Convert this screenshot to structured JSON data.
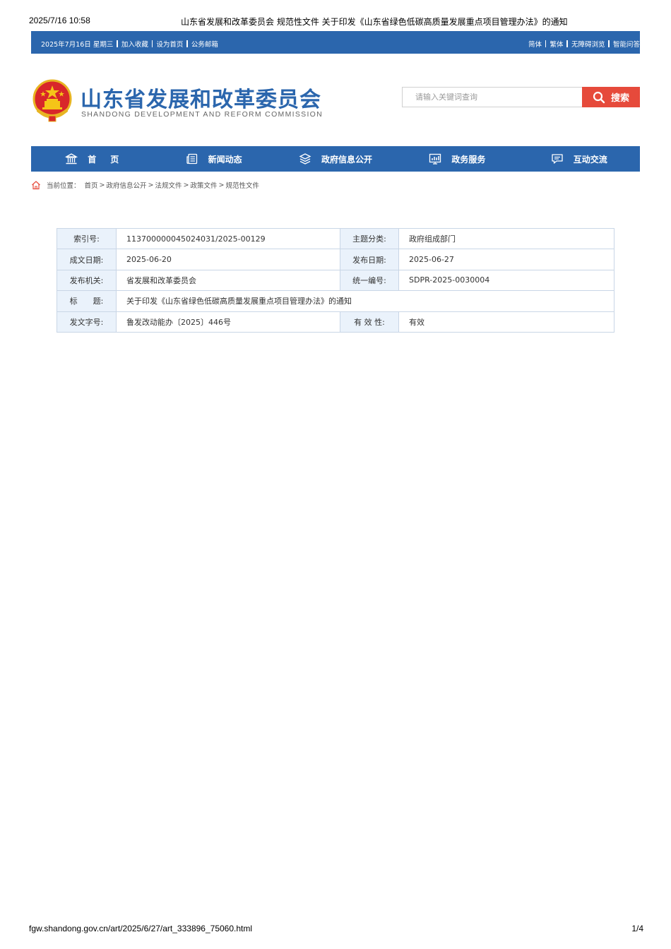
{
  "print_header": {
    "datetime": "2025/7/16 10:58",
    "page_title": "山东省发展和改革委员会 规范性文件 关于印发《山东省绿色低碳高质量发展重点项目管理办法》的通知"
  },
  "topbar": {
    "date_text": "2025年7月16日 星期三",
    "left_links": [
      "加入收藏",
      "设为首页",
      "公务邮箱"
    ],
    "right_links": [
      "简体",
      "繁体",
      "无障碍浏览",
      "智能问答"
    ]
  },
  "header": {
    "site_title": "山东省发展和改革委员会",
    "site_title_en": "SHANDONG DEVELOPMENT AND REFORM COMMISSION"
  },
  "search": {
    "placeholder": "请输入关键词查询",
    "button_label": "搜索"
  },
  "nav": {
    "items": [
      {
        "label": "首页",
        "icon": "building-icon"
      },
      {
        "label": "新闻动态",
        "icon": "news-icon"
      },
      {
        "label": "政府信息公开",
        "icon": "layers-icon"
      },
      {
        "label": "政务服务",
        "icon": "chart-board-icon"
      },
      {
        "label": "互动交流",
        "icon": "chat-icon"
      }
    ]
  },
  "breadcrumb": {
    "prefix": "当前位置：",
    "items": [
      "首页",
      "政府信息公开",
      "法规文件",
      "政策文件",
      "规范性文件"
    ]
  },
  "meta": {
    "index_label": "索引号:",
    "index_value": "113700000045024031/2025-00129",
    "category_label": "主题分类:",
    "category_value": "政府组成部门",
    "written_date_label": "成文日期:",
    "written_date_value": "2025-06-20",
    "publish_date_label": "发布日期:",
    "publish_date_value": "2025-06-27",
    "issuer_label": "发布机关:",
    "issuer_value": "省发展和改革委员会",
    "code_label": "统一编号:",
    "code_value": "SDPR-2025-0030004",
    "title_label": "标　　题:",
    "title_value": "关于印发《山东省绿色低碳高质量发展重点项目管理办法》的通知",
    "doc_no_label": "发文字号:",
    "doc_no_value": "鲁发改动能办〔2025〕446号",
    "validity_label": "有 效 性:",
    "validity_value": "有效",
    "validity_color": "#d9463a"
  },
  "print_footer": {
    "url": "fgw.shandong.gov.cn/art/2025/6/27/art_333896_75060.html",
    "page": "1/4"
  },
  "colors": {
    "brand_blue": "#2b66ad",
    "search_red": "#e64a3b",
    "table_label_bg": "#eaf2fb"
  }
}
